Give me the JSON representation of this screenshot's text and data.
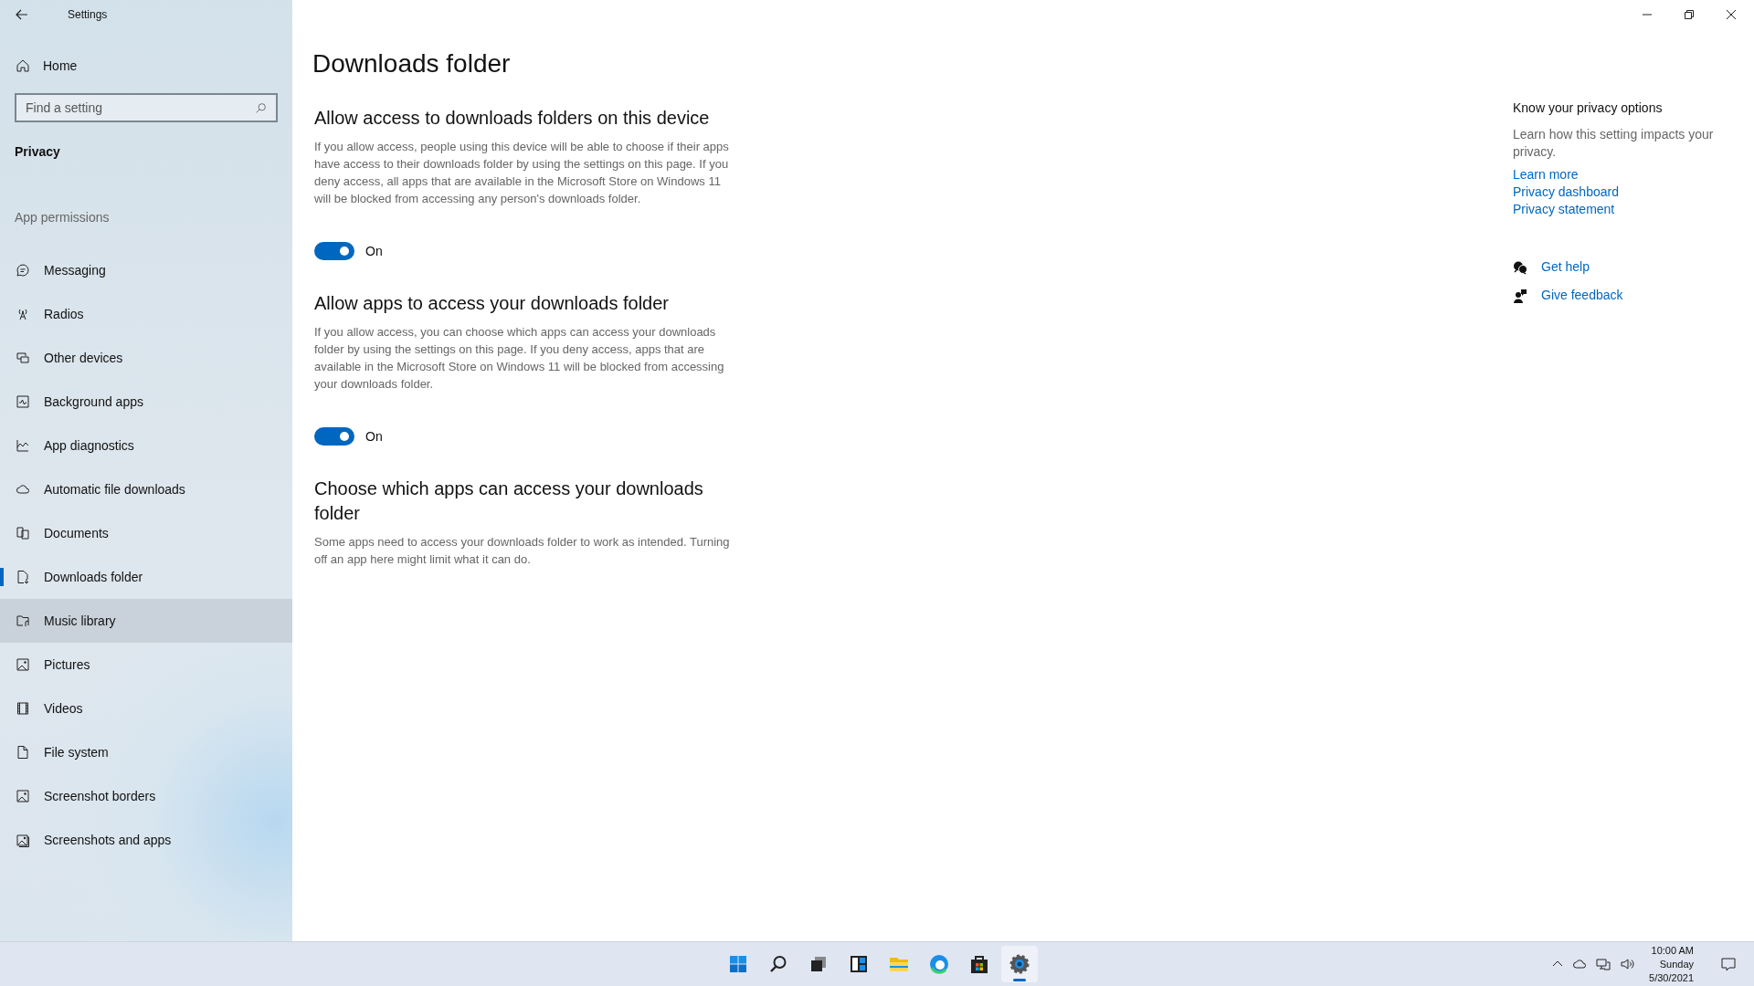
{
  "window": {
    "title": "Settings"
  },
  "sidebar": {
    "home": "Home",
    "search": {
      "placeholder": "Find a setting"
    },
    "section": "Privacy",
    "group": "App permissions",
    "items": [
      {
        "label": "Messaging",
        "selected": false,
        "highlighted": false
      },
      {
        "label": "Radios",
        "selected": false,
        "highlighted": false
      },
      {
        "label": "Other devices",
        "selected": false,
        "highlighted": false
      },
      {
        "label": "Background apps",
        "selected": false,
        "highlighted": false
      },
      {
        "label": "App diagnostics",
        "selected": false,
        "highlighted": false
      },
      {
        "label": "Automatic file downloads",
        "selected": false,
        "highlighted": false
      },
      {
        "label": "Documents",
        "selected": false,
        "highlighted": false
      },
      {
        "label": "Downloads folder",
        "selected": true,
        "highlighted": false
      },
      {
        "label": "Music library",
        "selected": false,
        "highlighted": true
      },
      {
        "label": "Pictures",
        "selected": false,
        "highlighted": false
      },
      {
        "label": "Videos",
        "selected": false,
        "highlighted": false
      },
      {
        "label": "File system",
        "selected": false,
        "highlighted": false
      },
      {
        "label": "Screenshot borders",
        "selected": false,
        "highlighted": false
      },
      {
        "label": "Screenshots and apps",
        "selected": false,
        "highlighted": false
      }
    ]
  },
  "page": {
    "title": "Downloads folder",
    "sections": [
      {
        "heading": "Allow access to downloads folders on this device",
        "text": "If you allow access, people using this device will be able to choose if their apps have access to their downloads folder by using the settings on this page. If you deny access, all apps that are available in the Microsoft Store on Windows 11 will be blocked from accessing any person's downloads folder.",
        "toggle": {
          "on": true,
          "label": "On"
        }
      },
      {
        "heading": "Allow apps to access your downloads folder",
        "text": "If you allow access, you can choose which apps can access your downloads folder by using the settings on this page. If you deny access, apps that are available in the Microsoft Store on Windows 11 will be blocked from accessing your downloads folder.",
        "toggle": {
          "on": true,
          "label": "On"
        }
      },
      {
        "heading": "Choose which apps can access your downloads folder",
        "text": "Some apps need to access your downloads folder to work as intended. Turning off an app here might limit what it can do."
      }
    ]
  },
  "aside": {
    "heading": "Know your privacy options",
    "text": "Learn how this setting impacts your privacy.",
    "links": [
      "Learn more",
      "Privacy dashboard",
      "Privacy statement"
    ],
    "help": [
      {
        "kind": "help",
        "label": "Get help"
      },
      {
        "kind": "feedback",
        "label": "Give feedback"
      }
    ]
  },
  "taskbar": {
    "apps": [
      {
        "selected": false
      },
      {
        "selected": false
      },
      {
        "selected": false
      },
      {
        "selected": false
      },
      {
        "selected": false
      },
      {
        "selected": false
      },
      {
        "selected": false
      },
      {
        "selected": true
      }
    ],
    "clock": {
      "time": "10:00 AM",
      "day": "Sunday",
      "date": "5/30/2021"
    }
  }
}
